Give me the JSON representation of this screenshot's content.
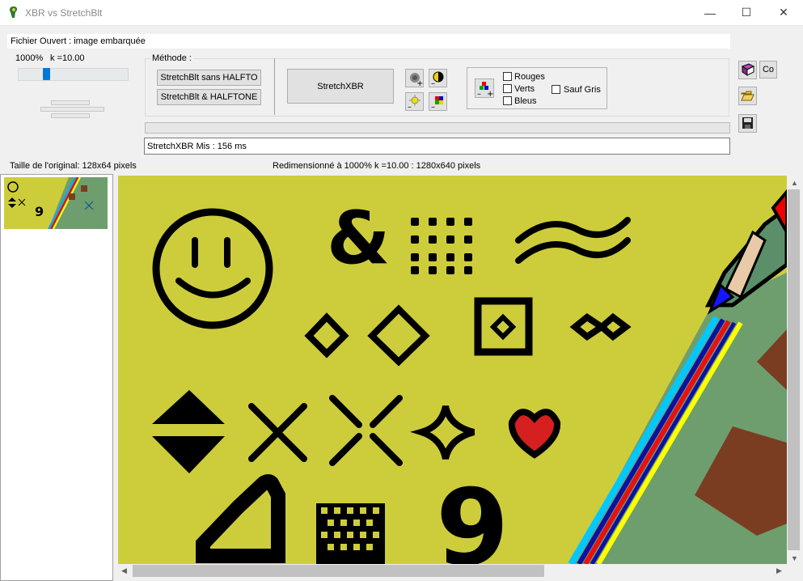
{
  "window": {
    "title": "XBR vs StretchBlt",
    "minimize": "—",
    "maximize": "☐",
    "close": "✕"
  },
  "file_label": "Fichier Ouvert : image embarquée",
  "zoom": {
    "percent_label": "1000%",
    "k_label": "k =10.00",
    "slider_level": 0.27
  },
  "method": {
    "group_label": "Méthode :",
    "btn_stretchblt_no_halftone": "StretchBlt sans HALFTO",
    "btn_stretchblt_halftone": "StretchBlt & HALFTONE",
    "btn_stretchxbr": "StretchXBR"
  },
  "channels": {
    "rouges": "Rouges",
    "verts": "Verts",
    "bleus": "Bleus",
    "sauf_gris": "Sauf Gris"
  },
  "side_buttons": {
    "co_label": "Co"
  },
  "status_text": "StretchXBR Mis : 156 ms",
  "original_size": "Taille de l'original:  128x64 pixels",
  "resized_info": "Redimensionné à 1000%   k =10.00 : 1280x640 pixels",
  "colors": {
    "canvas_bg": "#cdcd3c",
    "green": "#6e9e6e",
    "brown": "#7a3d22",
    "accent": "#0078d7"
  },
  "icons": [
    "app-icon",
    "book-icon",
    "open-folder-icon",
    "save-icon",
    "image-ops-icons"
  ]
}
